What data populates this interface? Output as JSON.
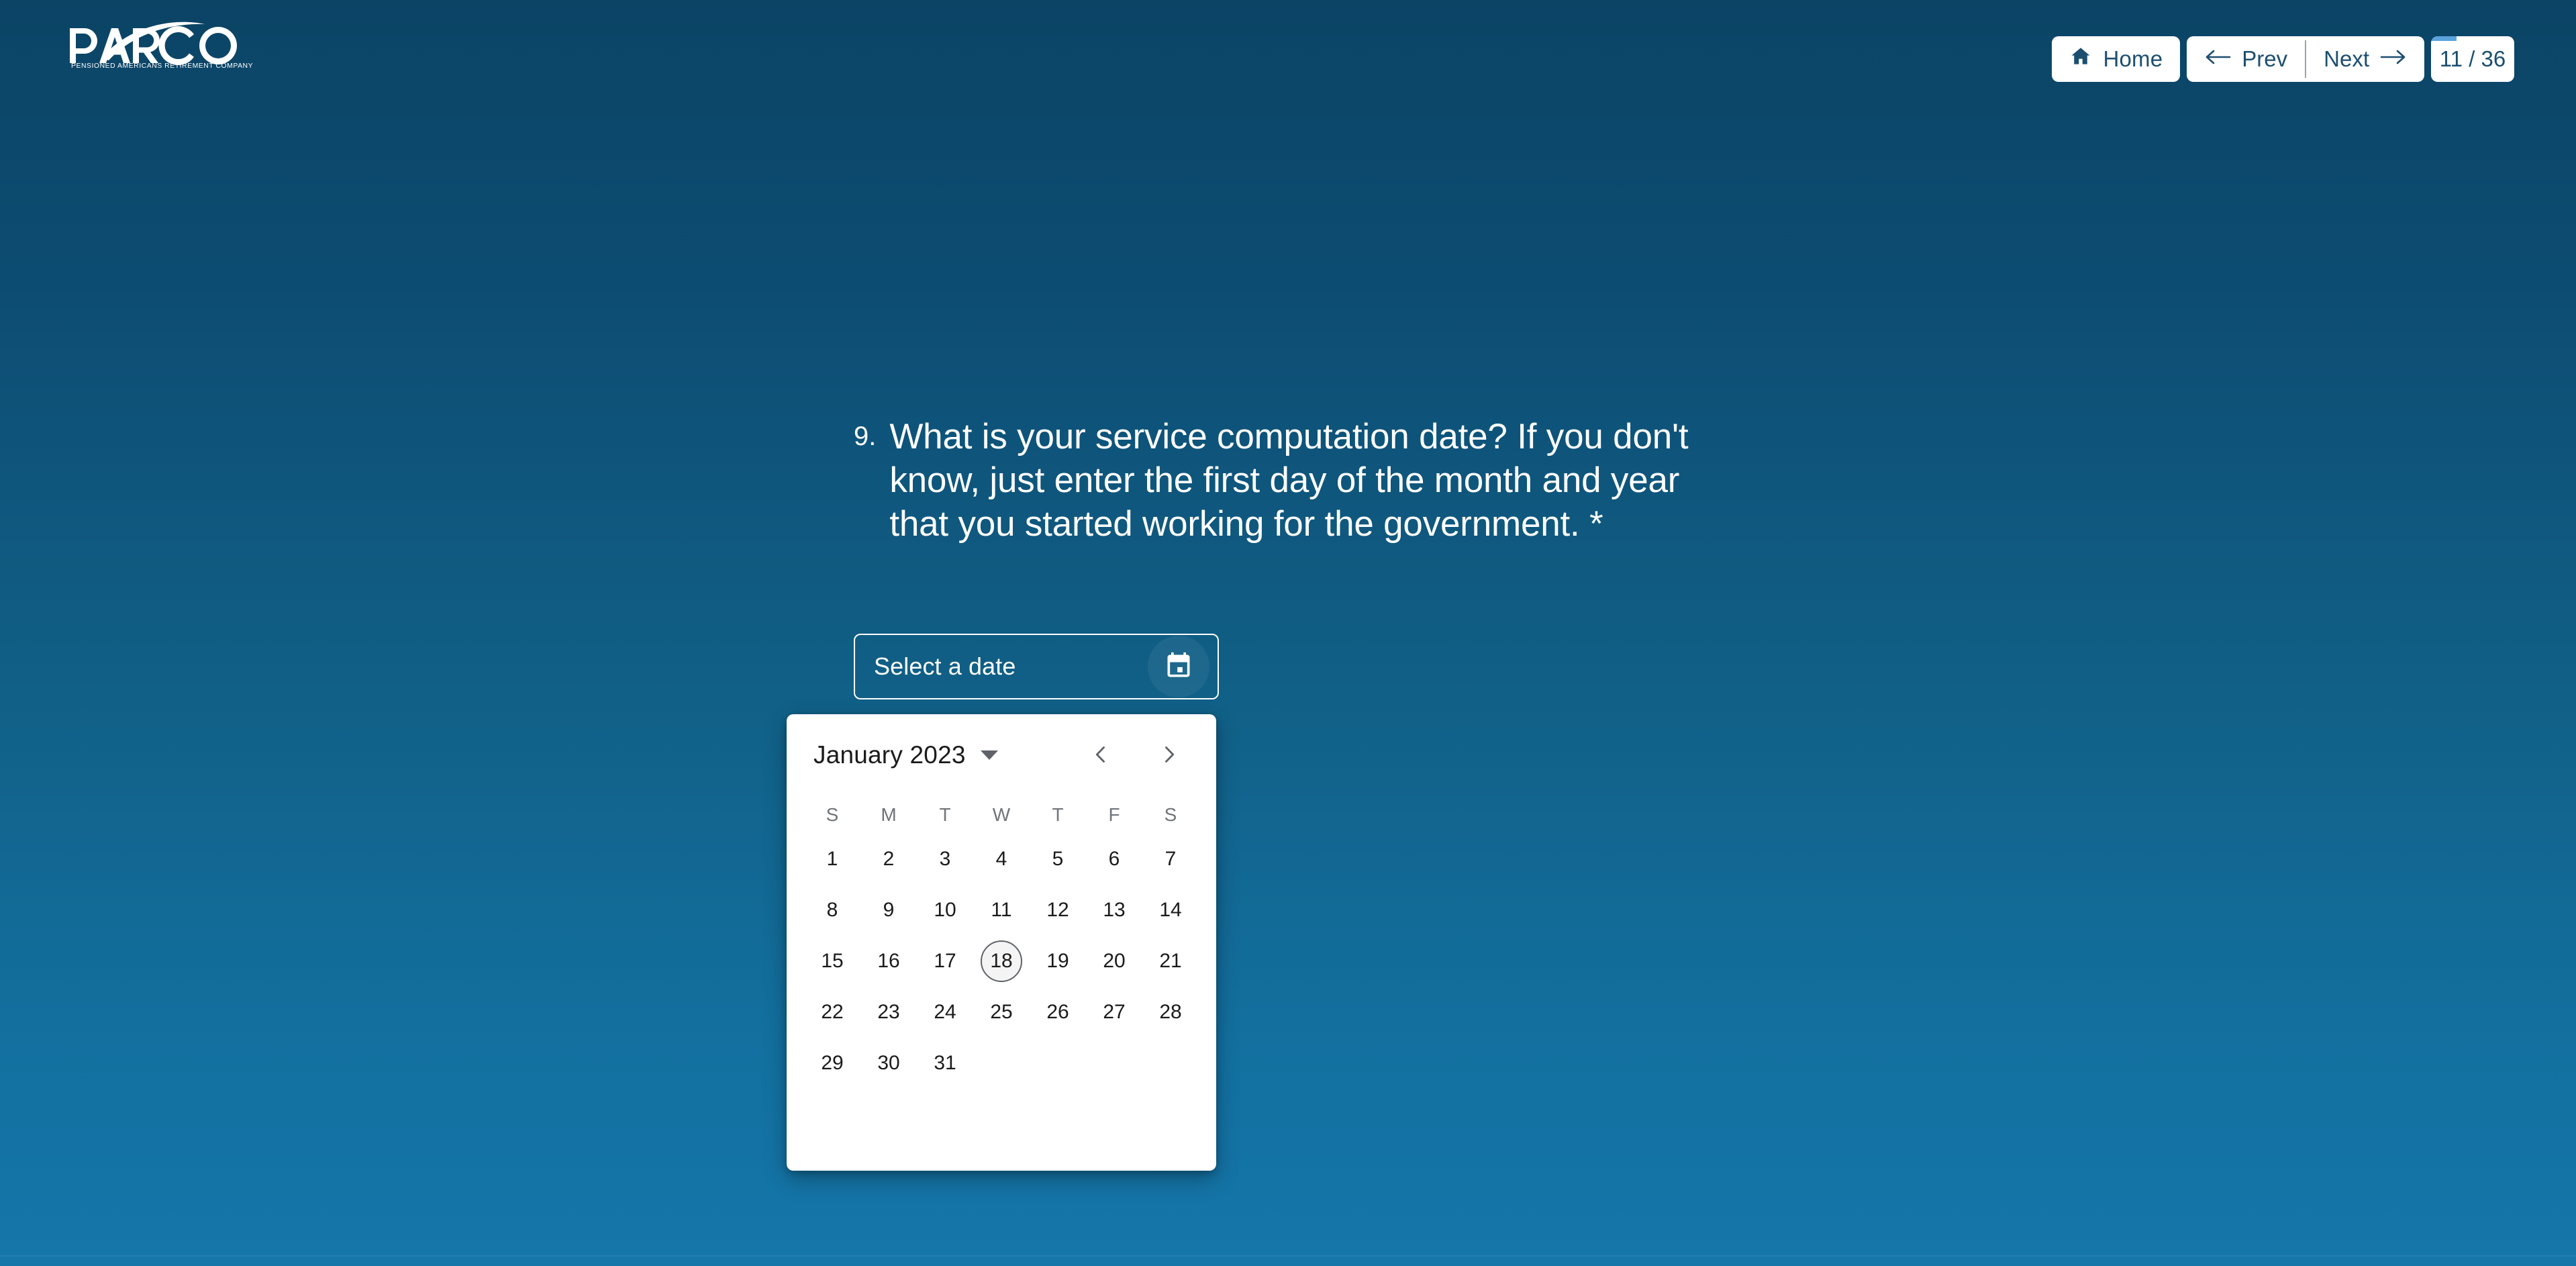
{
  "brand": {
    "name": "PARCO",
    "tagline": "PENSIONED AMERICANS RETIREMENT COMPANY"
  },
  "header": {
    "home_label": "Home",
    "prev_label": "Prev",
    "next_label": "Next",
    "counter": "11 / 36",
    "current_page": 11,
    "total_pages": 36,
    "home_icon": "home-icon",
    "prev_icon": "arrow-left-icon",
    "next_icon": "arrow-right-icon",
    "accent_color": "#5ba3dd",
    "button_text_color": "#1c4e70"
  },
  "question": {
    "number": "9.",
    "text": "What is your service computation date? If you don't know, just enter the first day of the month and year that you started working for the government. *",
    "required_marker": "*"
  },
  "date_input": {
    "placeholder": "Select a date",
    "value": "",
    "icon": "calendar-icon"
  },
  "calendar": {
    "month_label": "January 2023",
    "month": "January",
    "year": 2023,
    "dropdown_icon": "chevron-down-icon",
    "prev_icon": "chevron-left-icon",
    "next_icon": "chevron-right-icon",
    "weekdays": [
      "S",
      "M",
      "T",
      "W",
      "T",
      "F",
      "S"
    ],
    "leading_blanks": 0,
    "days": [
      1,
      2,
      3,
      4,
      5,
      6,
      7,
      8,
      9,
      10,
      11,
      12,
      13,
      14,
      15,
      16,
      17,
      18,
      19,
      20,
      21,
      22,
      23,
      24,
      25,
      26,
      27,
      28,
      29,
      30,
      31
    ],
    "today": 18,
    "selected": null
  },
  "theme": {
    "bg_top": "#0b4465",
    "bg_bottom": "#1576aa",
    "surface": "#ffffff",
    "text_on_dark": "#ffffff",
    "calendar_text": "#1b1b1b",
    "calendar_muted": "#70757a"
  }
}
